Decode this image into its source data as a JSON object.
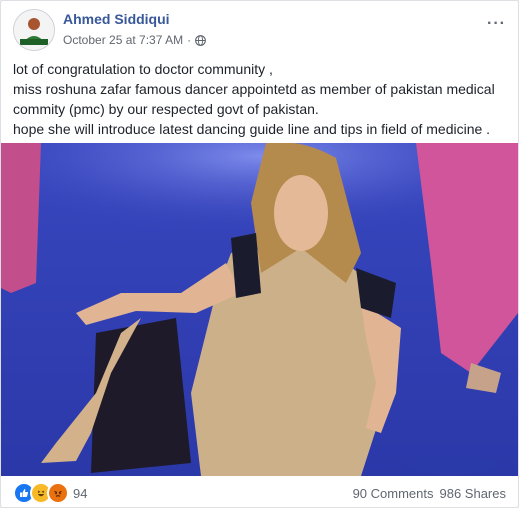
{
  "post": {
    "author": "Ahmed Siddiqui",
    "timestamp": "October 25 at 7:37 AM",
    "separator": "·",
    "privacy_icon": "globe-icon",
    "more_label": "···",
    "text": "lot of congratulation to doctor community ,\nmiss roshuna zafar famous dancer appointetd as member of pakistan medical commity (pmc) by our respected govt of pakistan.\nhope she will introduce latest dancing guide line and tips in field of medicine ."
  },
  "footer": {
    "reaction_icons": [
      "like-icon",
      "haha-icon",
      "angry-icon"
    ],
    "reaction_count": "94",
    "comments": "90 Comments",
    "shares": "986 Shares"
  },
  "colors": {
    "author_link": "#385898",
    "like": "#1877f2",
    "haha": "#f7b928",
    "angry": "#e9710f"
  }
}
